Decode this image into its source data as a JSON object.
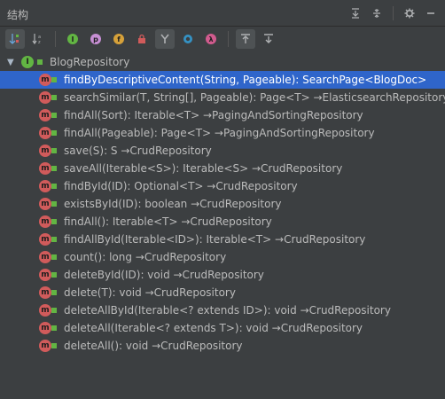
{
  "panel": {
    "title": "结构",
    "expand_all_icon": "expand-all-icon",
    "collapse_all_icon": "collapse-all-icon",
    "settings_icon": "gear-icon",
    "minimize_icon": "minimize-icon"
  },
  "toolbar": {
    "sort_visibility_icon": "sort-by-visibility-icon",
    "sort_alpha_icon": "sort-alphabetically-icon",
    "inherited_icon": "show-inherited-icon",
    "properties_icon": "show-properties-icon",
    "fields_icon": "show-fields-icon",
    "nonpublic_icon": "show-non-public-icon",
    "lambdas_icon": "show-lambdas-icon",
    "anonymous_icon": "show-anonymous-icon",
    "lambda_icon": "lambda-icon",
    "autoscroll_to_source_icon": "autoscroll-to-source-icon",
    "autoscroll_from_source_icon": "autoscroll-from-source-icon"
  },
  "tree": {
    "root": {
      "label": "BlogRepository",
      "icon": "interface-icon"
    },
    "members": [
      {
        "text": "findByDescriptiveContent(String, Pageable): SearchPage<BlogDoc>",
        "selected": true
      },
      {
        "text": "searchSimilar(T, String[], Pageable): Page<T> →ElasticsearchRepository"
      },
      {
        "text": "findAll(Sort): Iterable<T> →PagingAndSortingRepository"
      },
      {
        "text": "findAll(Pageable): Page<T> →PagingAndSortingRepository"
      },
      {
        "text": "save(S): S →CrudRepository"
      },
      {
        "text": "saveAll(Iterable<S>): Iterable<S> →CrudRepository"
      },
      {
        "text": "findById(ID): Optional<T> →CrudRepository"
      },
      {
        "text": "existsById(ID): boolean →CrudRepository"
      },
      {
        "text": "findAll(): Iterable<T> →CrudRepository"
      },
      {
        "text": "findAllById(Iterable<ID>): Iterable<T> →CrudRepository"
      },
      {
        "text": "count(): long →CrudRepository"
      },
      {
        "text": "deleteById(ID): void →CrudRepository"
      },
      {
        "text": "delete(T): void →CrudRepository"
      },
      {
        "text": "deleteAllById(Iterable<? extends ID>): void →CrudRepository"
      },
      {
        "text": "deleteAll(Iterable<? extends T>): void →CrudRepository"
      },
      {
        "text": "deleteAll(): void →CrudRepository"
      }
    ],
    "method_icon": "method-icon",
    "visibility_icon": "lock-icon"
  },
  "colors": {
    "background": "#3c3f41",
    "selection": "#2f65ca",
    "method_badge": "#d15b5b",
    "visibility": "#62b543"
  }
}
